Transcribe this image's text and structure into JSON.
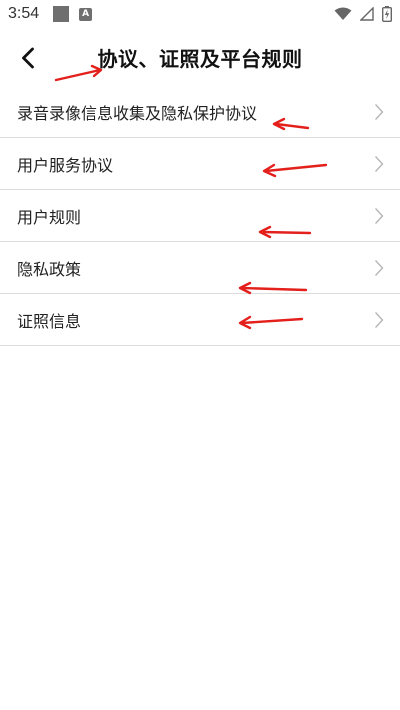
{
  "status_bar": {
    "time": "3:54",
    "a_badge": "A",
    "icons": [
      "notification-square-icon",
      "a-icon",
      "wifi-icon",
      "signal-icon",
      "battery-charging-icon"
    ]
  },
  "header": {
    "back_icon": "back-arrow-icon",
    "title": "协议、证照及平台规则"
  },
  "list": {
    "items": [
      {
        "label": "录音录像信息收集及隐私保护协议",
        "icon": "chevron-right-icon"
      },
      {
        "label": "用户服务协议",
        "icon": "chevron-right-icon"
      },
      {
        "label": "用户规则",
        "icon": "chevron-right-icon"
      },
      {
        "label": "隐私政策",
        "icon": "chevron-right-icon"
      },
      {
        "label": "证照信息",
        "icon": "chevron-right-icon"
      }
    ]
  },
  "colors": {
    "background": "#ffffff",
    "divider": "#dcdcdc",
    "text": "#222222",
    "chevron": "#b5b5b5",
    "annotation": "#e3201b"
  }
}
